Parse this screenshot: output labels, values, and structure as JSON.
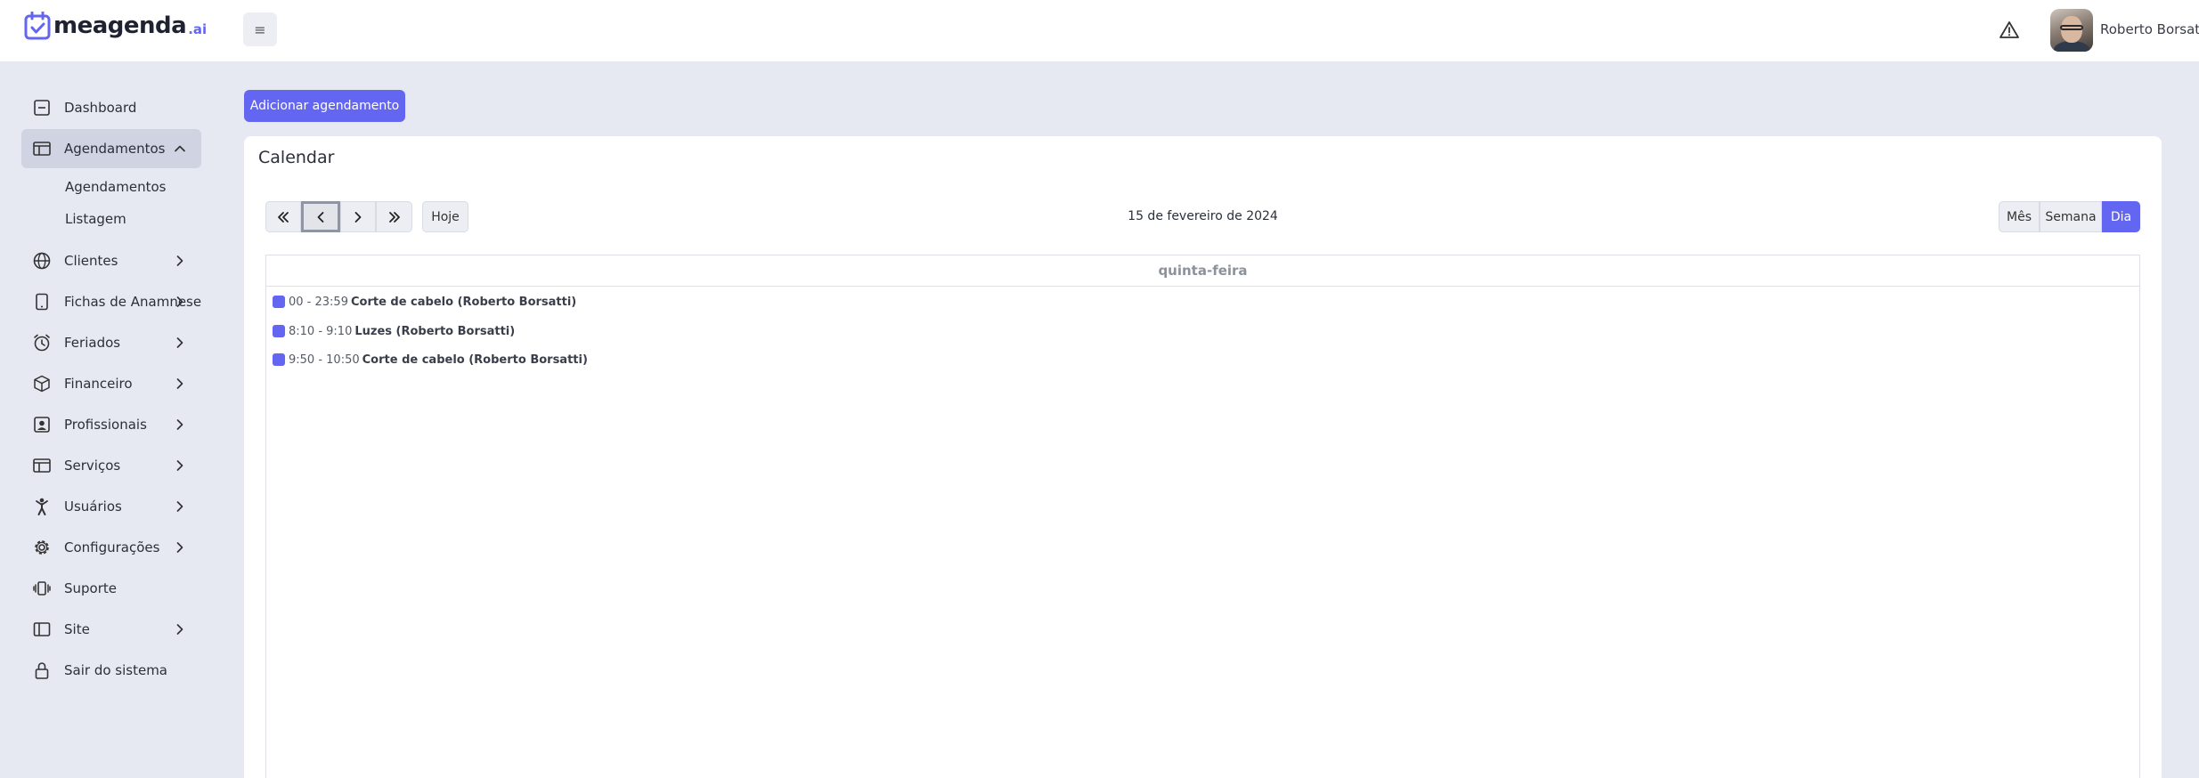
{
  "header": {
    "logo_text": "meagenda",
    "logo_suffix": ".ai",
    "menu_toggle_glyph": "≡",
    "user_name": "Roberto Borsatti"
  },
  "sidebar": {
    "items": [
      {
        "label": "Dashboard",
        "icon": "dashboard-icon"
      },
      {
        "label": "Agendamentos",
        "icon": "calendar-table-icon"
      },
      {
        "label": "Clientes",
        "icon": "globe-icon"
      },
      {
        "label": "Fichas de Anamnese",
        "icon": "tablet-icon"
      },
      {
        "label": "Feriados",
        "icon": "alarm-clock-icon"
      },
      {
        "label": "Financeiro",
        "icon": "box-icon"
      },
      {
        "label": "Profissionais",
        "icon": "person-badge-icon"
      },
      {
        "label": "Serviços",
        "icon": "layout-icon"
      },
      {
        "label": "Usuários",
        "icon": "person-icon"
      },
      {
        "label": "Configurações",
        "icon": "gear-icon"
      },
      {
        "label": "Suporte",
        "icon": "phone-vibrate-icon"
      },
      {
        "label": "Site",
        "icon": "sidebar-layout-icon"
      },
      {
        "label": "Sair do sistema",
        "icon": "lock-icon"
      }
    ],
    "subitems": [
      "Agendamentos",
      "Listagem"
    ]
  },
  "main": {
    "add_button": "Adicionar agendamento",
    "card_title": "Calendar",
    "today_button": "Hoje",
    "current_date": "15 de fevereiro de 2024",
    "views": [
      "Mês",
      "Semana",
      "Dia"
    ],
    "active_view": "Dia",
    "day_header": "quinta-feira",
    "events": [
      {
        "time": "00 - 23:59",
        "title": "Corte de cabelo (Roberto Borsatti)"
      },
      {
        "time": "8:10 - 9:10",
        "title": "Luzes (Roberto Borsatti)"
      },
      {
        "time": "9:50 - 10:50",
        "title": "Corte de cabelo (Roberto Borsatti)"
      }
    ]
  },
  "colors": {
    "accent": "#6366f1",
    "background": "#e7e9f2",
    "active_nav": "#d0d4e2"
  }
}
